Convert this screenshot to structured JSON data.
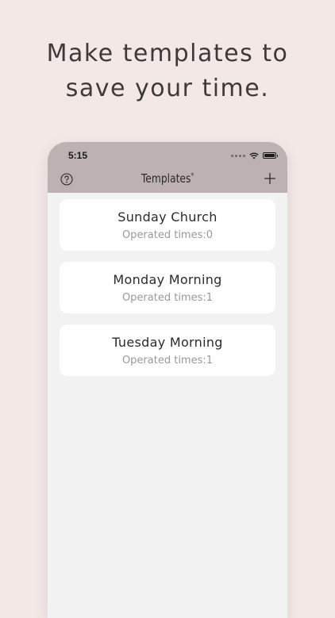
{
  "headline": {
    "line1": "Make templates to",
    "line2": "save your time."
  },
  "status_bar": {
    "time": "5:15"
  },
  "nav": {
    "title": "Templates",
    "title_mark": "*",
    "help_icon": "question-circle-icon",
    "add_icon": "plus-icon"
  },
  "templates": [
    {
      "name": "Sunday Church",
      "operated": "Operated times:0"
    },
    {
      "name": "Monday Morning",
      "operated": "Operated times:1"
    },
    {
      "name": "Tuesday Morning",
      "operated": "Operated times:1"
    }
  ],
  "colors": {
    "page_background": "#f4e8e7",
    "nav_background": "#bdb1b1",
    "list_background": "#f2f2f2",
    "card_background": "#ffffff"
  }
}
